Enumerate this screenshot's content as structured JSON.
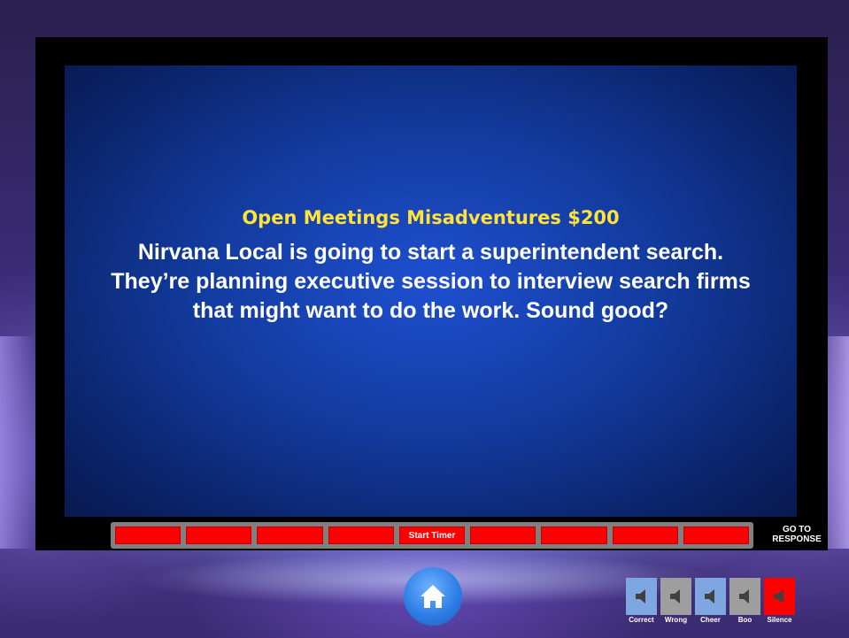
{
  "clue": {
    "category_heading": "Open Meetings Misadventures $200",
    "text": "Nirvana Local is going to start a superintendent search.  They’re planning executive session to interview search firms that might want to do the work.  Sound good?"
  },
  "timer": {
    "start_label": "Start Timer",
    "segment_color": "#ff0000"
  },
  "navigation": {
    "go_to_response_label": "GO TO\nRESPONSE",
    "home_icon": "home-icon"
  },
  "sounds": [
    {
      "label": "Correct",
      "color": "#7ea6e0",
      "icon": "speaker-icon"
    },
    {
      "label": "Wrong",
      "color": "#9e9e9e",
      "icon": "speaker-icon"
    },
    {
      "label": "Cheer",
      "color": "#7ea6e0",
      "icon": "speaker-icon"
    },
    {
      "label": "Boo",
      "color": "#9e9e9e",
      "icon": "speaker-icon"
    },
    {
      "label": "Silence",
      "color": "#ff0000",
      "icon": "speaker-icon"
    }
  ]
}
